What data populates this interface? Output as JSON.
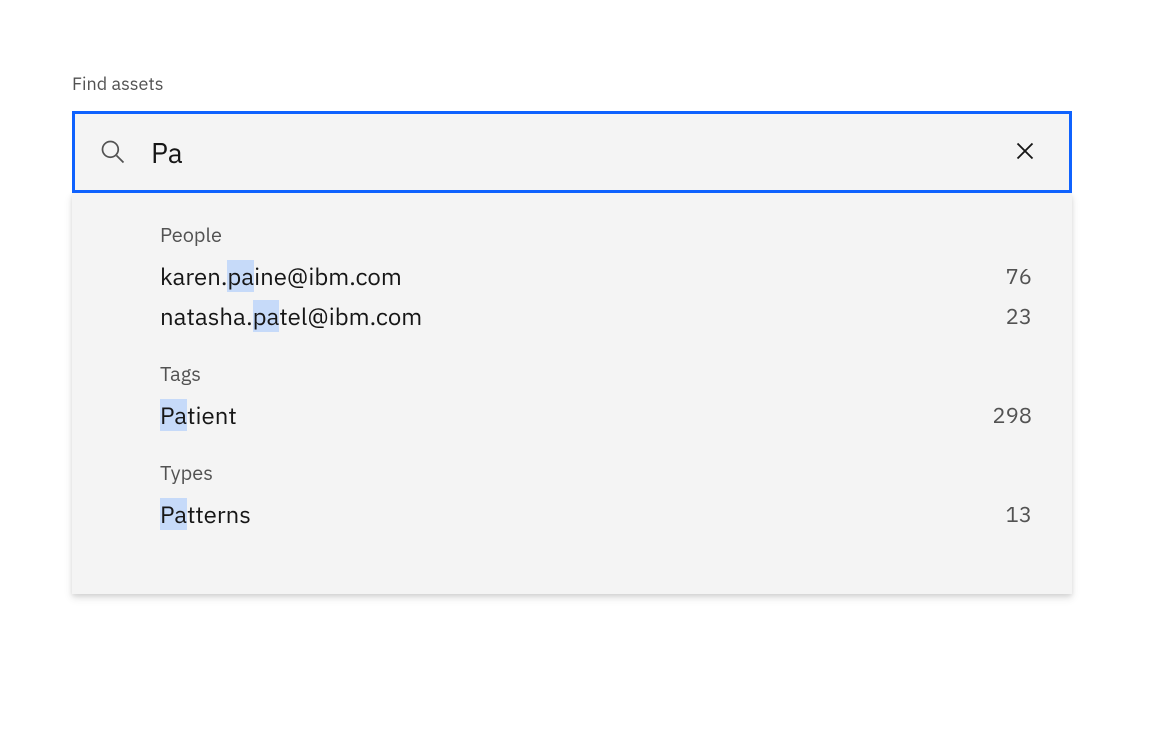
{
  "label": "Find assets",
  "search": {
    "value": "Pa"
  },
  "groups": [
    {
      "label": "People",
      "items": [
        {
          "prefix": "karen.",
          "highlight": "pa",
          "suffix": "ine@ibm.com",
          "count": "76"
        },
        {
          "prefix": "natasha.",
          "highlight": "pa",
          "suffix": "tel@ibm.com",
          "count": "23"
        }
      ]
    },
    {
      "label": "Tags",
      "items": [
        {
          "prefix": "",
          "highlight": "Pa",
          "suffix": "tient",
          "count": "298"
        }
      ]
    },
    {
      "label": "Types",
      "items": [
        {
          "prefix": "",
          "highlight": "Pa",
          "suffix": "tterns",
          "count": "13"
        }
      ]
    }
  ]
}
